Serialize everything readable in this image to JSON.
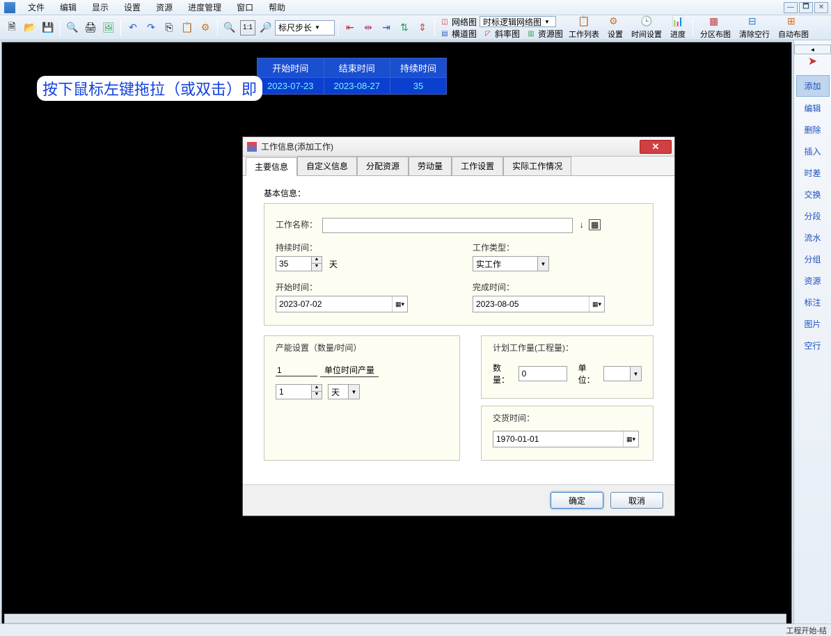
{
  "menu": {
    "items": [
      "文件",
      "编辑",
      "显示",
      "设置",
      "资源",
      "进度管理",
      "窗口",
      "帮助"
    ]
  },
  "toolbar": {
    "ruler_step": "标尺步长",
    "view_net_combo": "时标逻辑网络图",
    "row1": [
      {
        "label": "网络图"
      },
      {
        "label": "横道图"
      }
    ],
    "row2": [
      {
        "label": "斜率图"
      },
      {
        "label": "资源图"
      }
    ],
    "big": [
      "工作列表",
      "设置",
      "时间设置",
      "进度"
    ],
    "right_big": [
      "分区布图",
      "清除空行",
      "自动布图"
    ]
  },
  "canvas": {
    "drag_hint": "按下鼠标左键拖拉（或双击）即",
    "table_headers": [
      "开始时间",
      "结束时间",
      "持续时间"
    ],
    "table_row": [
      "2023-07-23",
      "2023-08-27",
      "35"
    ]
  },
  "right_panel": {
    "items": [
      "添加",
      "编辑",
      "删除",
      "插入",
      "时差",
      "交换",
      "分段",
      "流水",
      "分组",
      "资源",
      "标注",
      "图片",
      "空行"
    ],
    "selected_index": 0
  },
  "dialog": {
    "title": "工作信息(添加工作)",
    "tabs": [
      "主要信息",
      "自定义信息",
      "分配资源",
      "劳动量",
      "工作设置",
      "实际工作情况"
    ],
    "active_tab": 0,
    "basic_info": "基本信息：",
    "labels": {
      "task_name": "工作名称：",
      "duration": "持续时间：",
      "duration_unit": "天",
      "work_type": "工作类型：",
      "start_time": "开始时间：",
      "end_time": "完成时间：",
      "capacity_title": "产能设置（数量/时间）",
      "unit_output": "单位时间产量",
      "capacity_unit": "天",
      "planned_title": "计划工作量(工程量)：",
      "qty": "数量：",
      "unit": "单位：",
      "delivery": "交货时间："
    },
    "values": {
      "task_name": "",
      "duration": "35",
      "work_type": "实工作",
      "start_date": "2023-07-02",
      "end_date": "2023-08-05",
      "capacity_qty": "1",
      "capacity_time": "1",
      "planned_qty": "0",
      "planned_unit": "",
      "delivery_date": "1970-01-01"
    },
    "buttons": {
      "ok": "确定",
      "cancel": "取消"
    }
  },
  "status": {
    "right_text": "工程开始-结"
  }
}
